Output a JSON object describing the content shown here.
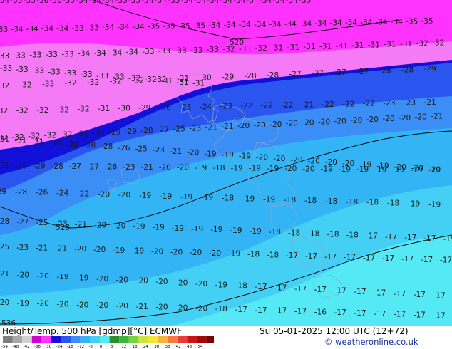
{
  "isotherm_labels": [
    {
      "row": "r0",
      "values": [
        "-34",
        "-35",
        "-35",
        "-36",
        "-36",
        "-35",
        "-34",
        "-34",
        "-34",
        "-35",
        "-35",
        "-34",
        "-34",
        "-35",
        "-34",
        "-34",
        "-34",
        "-34",
        "-34",
        "-34",
        "-34",
        "-34",
        "-34",
        "-35"
      ]
    },
    {
      "row": "r1",
      "values": [
        "-33",
        "-34",
        "-34",
        "-34",
        "-34",
        "-33",
        "-33",
        "-34",
        "-34",
        "-34",
        "-35",
        "-35",
        "-35",
        "-35",
        "-34",
        "-34",
        "-34",
        "-34",
        "-34",
        "-34",
        "-34",
        "-34",
        "-34",
        "-34",
        "-34",
        "-34",
        "-34",
        "-35",
        "-35"
      ]
    },
    {
      "row": "r2",
      "values": [
        "-33",
        "-33",
        "-33",
        "-33",
        "-33",
        "-34",
        "-34",
        "-34",
        "-34",
        "-33",
        "-33",
        "-33",
        "-33",
        "-33",
        "-32",
        "-33",
        "-32",
        "-31",
        "-31",
        "-31",
        "-31",
        "-31",
        "-31",
        "-31",
        "-31",
        "-31",
        "-32",
        "-32"
      ]
    },
    {
      "row": "r3",
      "values": [
        "-33",
        "-33",
        "-33",
        "-33",
        "-33",
        "-33",
        "-33",
        "-33",
        "-32",
        "-32",
        "-31",
        "-31",
        "-31"
      ]
    },
    {
      "row": "r4",
      "values": [
        "-32",
        "-32",
        "-33",
        "-32",
        "-32",
        "-32",
        "-32",
        "-32",
        "-31",
        "-30",
        "-29",
        "-28",
        "-28",
        "-27",
        "-27",
        "-27",
        "-27",
        "-28",
        "-28",
        "-29"
      ]
    },
    {
      "row": "r5",
      "values": [
        "-32",
        "-32",
        "-32",
        "-32",
        "-32",
        "-31",
        "-30",
        "-29",
        "-26",
        "-25",
        "-24",
        "-23",
        "-22",
        "-22",
        "-22",
        "-21",
        "-22",
        "-22",
        "-22",
        "-23",
        "-23",
        "-21"
      ]
    },
    {
      "row": "r6",
      "values": [
        "-32",
        "-32",
        "-32",
        "-32",
        "-32",
        "-31",
        "-30",
        "-29",
        "-29",
        "-28",
        "-27",
        "-25",
        "-23",
        "-21",
        "-21",
        "-20",
        "-20",
        "-20",
        "-20",
        "-20",
        "-20",
        "-20",
        "-20",
        "-20",
        "-20",
        "-20",
        "-20",
        "-21"
      ]
    },
    {
      "row": "r7",
      "values": [
        "-31",
        "-31",
        "-31",
        "-30",
        "-29",
        "-28",
        "-28",
        "-26",
        "-25",
        "-23",
        "-21",
        "-20",
        "-19",
        "-19",
        "-19",
        "-20",
        "-20",
        "-20",
        "-20",
        "-20",
        "-20",
        "-19",
        "-19",
        "-20",
        "-20",
        "-20"
      ]
    },
    {
      "row": "r8",
      "values": [
        "-31",
        "-30",
        "-29",
        "-28",
        "-27",
        "-27",
        "-26",
        "-23",
        "-21",
        "-20",
        "-20",
        "-19",
        "-18",
        "-19",
        "-19",
        "-19",
        "-20",
        "-20",
        "-19",
        "-19",
        "-19",
        "-19",
        "-19",
        "-19",
        "-19"
      ]
    },
    {
      "row": "r9",
      "values": [
        "-29",
        "-28",
        "-26",
        "-24",
        "-22",
        "-20",
        "-20",
        "-19",
        "-19",
        "-19",
        "-19",
        "-18",
        "-19",
        "-19",
        "-18",
        "-18",
        "-18",
        "-18",
        "-18",
        "-18",
        "-19",
        "-19"
      ]
    },
    {
      "row": "r10",
      "values": [
        "-28",
        "-27",
        "-25",
        "-23",
        "-21",
        "-20",
        "-20",
        "-19",
        "-19",
        "-19",
        "-19",
        "-19",
        "-19",
        "-19",
        "-18",
        "-18",
        "-18",
        "-18",
        "-18",
        "-17",
        "-17",
        "-17",
        "-17",
        "-15"
      ]
    },
    {
      "row": "r11",
      "values": [
        "-25",
        "-23",
        "-21",
        "-21",
        "-20",
        "-20",
        "-19",
        "-19",
        "-20",
        "-20",
        "-20",
        "-20",
        "-19",
        "-18",
        "-18",
        "-17",
        "-17",
        "-17",
        "-17",
        "-17",
        "-17",
        "-17",
        "-17",
        "-17"
      ]
    },
    {
      "row": "r12",
      "values": [
        "-21",
        "-20",
        "-20",
        "-19",
        "-19",
        "-20",
        "-20",
        "-20",
        "-20",
        "-20",
        "-20",
        "-19",
        "-18",
        "-17",
        "-17",
        "-17",
        "-17",
        "-17",
        "-17",
        "-17",
        "-17",
        "-17",
        "-17"
      ]
    },
    {
      "row": "r13",
      "values": [
        "-20",
        "-19",
        "-20",
        "-20",
        "-20",
        "-20",
        "-20",
        "-21",
        "-20",
        "-20",
        "-20",
        "-18",
        "-17",
        "-17",
        "-17",
        "-17",
        "-16",
        "-17",
        "-17",
        "-17",
        "-17",
        "-17",
        "-17"
      ]
    }
  ],
  "height_contours": [
    {
      "label": "520"
    },
    {
      "label": "528"
    },
    {
      "label": "536"
    }
  ],
  "footer": {
    "title": "Height/Temp. 500 hPa [gdmp][°C] ECMWF",
    "valid_time": "Su 05-01-2025 12:00 UTC (12+72)",
    "credit": "© weatheronline.co.uk"
  },
  "scale_ticks": [
    "-54",
    "-48",
    "-42",
    "-38",
    "-30",
    "-24",
    "-18",
    "-12",
    "-8",
    "0",
    "8",
    "12",
    "18",
    "24",
    "30",
    "38",
    "42",
    "48",
    "54"
  ],
  "colors": {
    "very_cold": "#ff33ff",
    "cold": "#f57af5",
    "band_blue_dark": "#1010d8",
    "band_blue": "#2a55ee",
    "band_blue_mid": "#3a8ef5",
    "band_cyan": "#33b5f5",
    "band_cyan_light": "#44d0f5",
    "band_aqua": "#55e8f5"
  }
}
